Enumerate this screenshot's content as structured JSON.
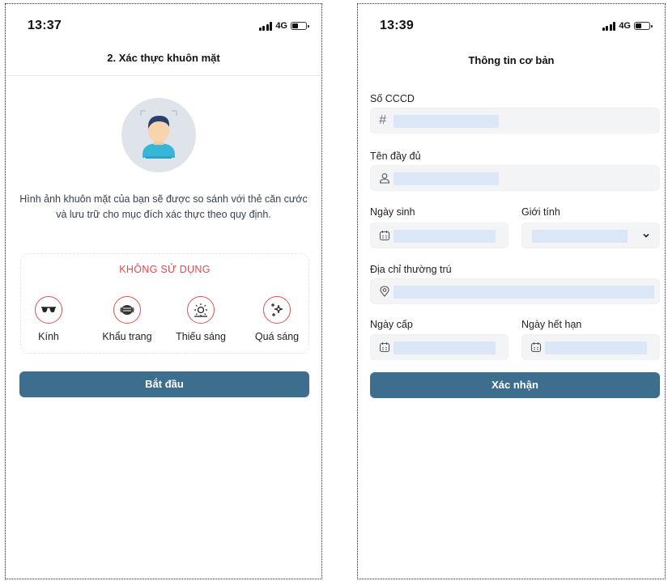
{
  "left_screen": {
    "status": {
      "time": "13:37",
      "network": "4G"
    },
    "title": "2. Xác thực khuôn mặt",
    "description": "Hình ảnh khuôn mặt của bạn sẽ được so sánh với thẻ căn cước và lưu trữ cho mục đích xác thực theo quy định.",
    "not_use": {
      "title": "KHÔNG SỬ DỤNG",
      "items": [
        {
          "label": "Kính",
          "icon": "glasses-icon"
        },
        {
          "label": "Khẩu trang",
          "icon": "mask-icon"
        },
        {
          "label": "Thiếu sáng",
          "icon": "low-light-icon"
        },
        {
          "label": "Quá sáng",
          "icon": "sparkle-icon"
        }
      ]
    },
    "start_button": "Bắt đầu"
  },
  "right_screen": {
    "status": {
      "time": "13:39",
      "network": "4G"
    },
    "title": "Thông tin cơ bản",
    "fields": {
      "id_number": {
        "label": "Số CCCD",
        "icon": "hash-icon"
      },
      "full_name": {
        "label": "Tên đầy đủ",
        "icon": "user-icon"
      },
      "dob": {
        "label": "Ngày sinh",
        "icon": "calendar-icon"
      },
      "gender": {
        "label": "Giới tính",
        "icon": "chevron-down-icon"
      },
      "address": {
        "label": "Địa chỉ thường trú",
        "icon": "location-pin-icon"
      },
      "issue_date": {
        "label": "Ngày cấp",
        "icon": "calendar-icon"
      },
      "expiry_date": {
        "label": "Ngày hết hạn",
        "icon": "calendar-icon"
      }
    },
    "confirm_button": "Xác nhận"
  },
  "colors": {
    "primary_button": "#3e6e8e",
    "warning_red": "#e04a4a",
    "field_bg": "#f3f4f6",
    "masked_value": "#dbe7f6"
  }
}
